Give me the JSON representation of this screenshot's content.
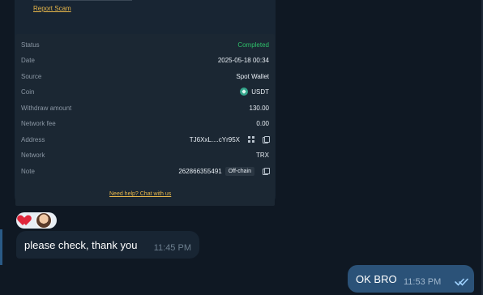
{
  "card": {
    "report_scam": "Report Scam",
    "help_link": "Need help? Chat with us",
    "rows": [
      {
        "label": "Status",
        "value": "Completed"
      },
      {
        "label": "Date",
        "value": "2025-05-18 00:34"
      },
      {
        "label": "Source",
        "value": "Spot Wallet"
      },
      {
        "label": "Coin",
        "value": "USDT"
      },
      {
        "label": "Withdraw amount",
        "value": "130.00"
      },
      {
        "label": "Network fee",
        "value": "0.00"
      },
      {
        "label": "Address",
        "value": "TJ6XxL....cYr95X"
      },
      {
        "label": "Network",
        "value": "TRX"
      },
      {
        "label": "Note",
        "value": "262866355491",
        "badge": "Off-chain"
      }
    ]
  },
  "messages": {
    "incoming": {
      "text": "please check, thank you",
      "time": "11:45 PM"
    },
    "outgoing": {
      "text": "OK BRO",
      "time": "11:53 PM"
    }
  },
  "colors": {
    "accent_gold": "#e6b64a",
    "status_green": "#2fbf6a",
    "outgoing_bubble": "#2b5278",
    "incoming_bubble": "#182533"
  },
  "icons": {
    "coin": "usdt-icon",
    "copy": "copy-icon",
    "qr": "qr-icon",
    "reaction_1": "heart-icon",
    "reaction_2": "avatar",
    "read_status": "double-check-icon"
  }
}
